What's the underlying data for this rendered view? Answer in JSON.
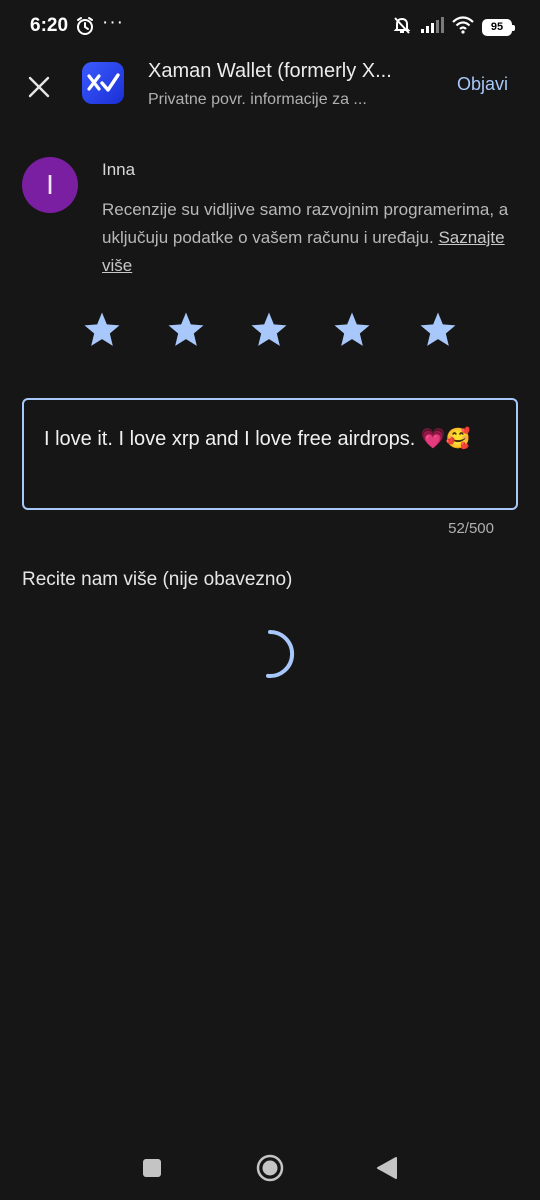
{
  "status_bar": {
    "time": "6:20",
    "more": "···",
    "battery": "95",
    "icons": [
      "alarm-icon",
      "mute-bell-icon",
      "signal-icon",
      "wifi-icon",
      "battery-icon"
    ]
  },
  "header": {
    "app_title": "Xaman Wallet (formerly X...",
    "app_subtitle": "Privatne povr. informacije za ...",
    "post_label": "Objavi",
    "close_icon": "close-icon",
    "app_icon": "xaman-app-icon"
  },
  "user": {
    "initial": "I",
    "name": "Inna",
    "disclaimer": "Recenzije su vidljive samo razvojnim programerima, a uključuju podatke o vašem računu i uređaju.",
    "learn_more": "Saznajte više"
  },
  "rating": {
    "value": 5,
    "max": 5
  },
  "review": {
    "text": "I love it. I love xrp and I love free airdrops. 💗🥰",
    "counter": "52/500"
  },
  "tell_more": {
    "label": "Recite nam više (nije obavezno)"
  },
  "colors": {
    "background": "#161616",
    "accent": "#a8c7fa",
    "avatar": "#7b1fa2"
  }
}
